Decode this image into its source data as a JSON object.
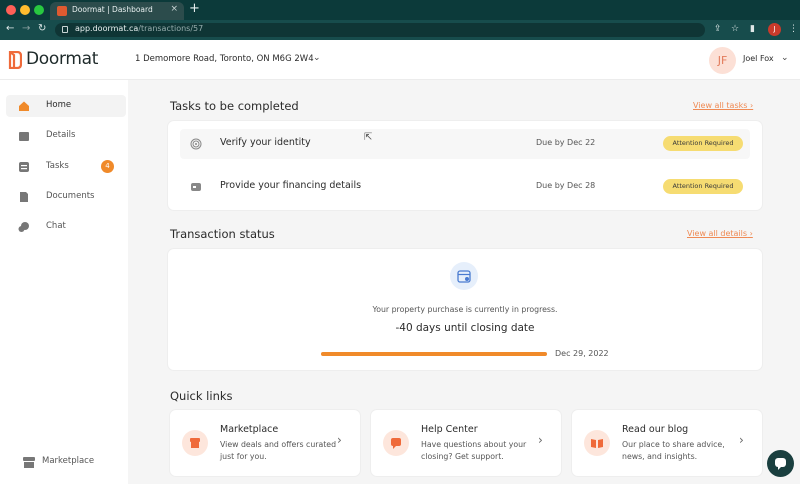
{
  "browser": {
    "tab_title": "Doormat | Dashboard",
    "tab_close": "×",
    "new_tab": "+",
    "url_host": "app.doormat.ca",
    "url_path": "/transactions/57",
    "profile_initial": "J"
  },
  "header": {
    "logo_text": "Doormat",
    "property_address": "1 Demomore Road, Toronto, ON M6G 2W4",
    "user_initials": "JF",
    "user_name": "Joel Fox"
  },
  "sidebar": {
    "items": [
      {
        "label": "Home",
        "icon": "home-icon"
      },
      {
        "label": "Details",
        "icon": "folder-icon"
      },
      {
        "label": "Tasks",
        "icon": "checklist-icon",
        "badge": "4"
      },
      {
        "label": "Documents",
        "icon": "document-icon"
      },
      {
        "label": "Chat",
        "icon": "chat-icon"
      }
    ],
    "bottom_label": "Marketplace"
  },
  "tasks": {
    "title": "Tasks to be completed",
    "link": "View all tasks",
    "items": [
      {
        "label": "Verify your identity",
        "due": "Due by Dec 22",
        "status": "Attention Required"
      },
      {
        "label": "Provide your financing details",
        "due": "Due by Dec 28",
        "status": "Attention Required"
      }
    ]
  },
  "transaction": {
    "title": "Transaction status",
    "link": "View all details",
    "message": "Your property purchase is currently in progress.",
    "countdown": "-40 days until closing date",
    "closing_date": "Dec 29, 2022",
    "progress_fraction": 1.0
  },
  "quick_links": {
    "title": "Quick links",
    "items": [
      {
        "title": "Marketplace",
        "desc": "View deals and offers curated just for you."
      },
      {
        "title": "Help Center",
        "desc": "Have questions about your closing? Get support."
      },
      {
        "title": "Read our blog",
        "desc": "Our place to share advice, news, and insights."
      }
    ]
  },
  "colors": {
    "accent": "#f08a2a",
    "link": "#ef8a54",
    "attention": "#f6dc72",
    "browser_bar": "#174c4c"
  }
}
